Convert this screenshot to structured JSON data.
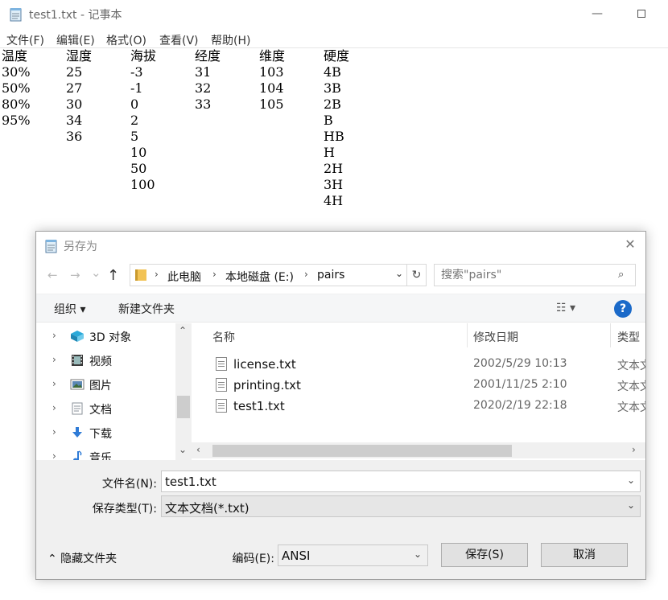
{
  "notepad": {
    "title": "test1.txt - 记事本",
    "min_glyph": "—",
    "menu": [
      "文件(F)",
      "编辑(E)",
      "格式(O)",
      "查看(V)",
      "帮助(H)"
    ],
    "columns": [
      [
        "温度",
        "30%",
        "50%",
        "80%",
        "95%"
      ],
      [
        "湿度",
        "25",
        "27",
        "30",
        "34",
        "36"
      ],
      [
        "海拔",
        "-3",
        "-1",
        "0",
        "2",
        "5",
        "10",
        "50",
        "100"
      ],
      [
        "经度",
        "31",
        "32",
        "33"
      ],
      [
        "维度",
        "103",
        "104",
        "105"
      ],
      [
        "硬度",
        "4B",
        "3B",
        "2B",
        "B",
        "HB",
        "H",
        "2H",
        "3H",
        "4H"
      ]
    ]
  },
  "dialog": {
    "title": "另存为",
    "close_glyph": "✕",
    "nav": {
      "back": "←",
      "forward": "→",
      "recent": "⌄",
      "up": "↑"
    },
    "breadcrumb": [
      "此电脑",
      "本地磁盘 (E:)",
      "pairs"
    ],
    "breadcrumb_sep": "›",
    "dropdown_glyph": "⌄",
    "refresh_glyph": "↻",
    "search_placeholder": "搜索\"pairs\"",
    "search_glyph": "⌕",
    "toolbar": {
      "organize": "组织 ▾",
      "new_folder": "新建文件夹",
      "view": "☷ ▾",
      "help": "?"
    },
    "nav_pane": {
      "caret": "›",
      "scroll_up": "⌃",
      "scroll_down": "⌄",
      "items": [
        {
          "label": "3D 对象",
          "icon": "cube-icon",
          "color": "#2aa9d9"
        },
        {
          "label": "视频",
          "icon": "film-icon",
          "color": "#3a3a3a"
        },
        {
          "label": "图片",
          "icon": "picture-icon",
          "color": "#5b87b5"
        },
        {
          "label": "文档",
          "icon": "document-icon",
          "color": "#8a9099"
        },
        {
          "label": "下载",
          "icon": "download-arrow-icon",
          "color": "#2f7bd6"
        },
        {
          "label": "音乐",
          "icon": "music-note-icon",
          "color": "#2f7bd6"
        }
      ]
    },
    "files": {
      "headers": {
        "name": "名称",
        "date": "修改日期",
        "type": "类型",
        "sort_glyph": "˄"
      },
      "rows": [
        {
          "name": "license.txt",
          "date": "2002/5/29 10:13",
          "type": "文本文档"
        },
        {
          "name": "printing.txt",
          "date": "2001/11/25 2:10",
          "type": "文本文档"
        },
        {
          "name": "test1.txt",
          "date": "2020/2/19 22:18",
          "type": "文本文档"
        }
      ],
      "scroll_left": "‹",
      "scroll_right": "›"
    },
    "filename_label": "文件名(N):",
    "filename_value": "test1.txt",
    "filetype_label": "保存类型(T):",
    "filetype_value": "文本文档(*.txt)",
    "hide_folders": "⌃  隐藏文件夹",
    "encoding_label": "编码(E):",
    "encoding_value": "ANSI",
    "save_button": "保存(S)",
    "cancel_button": "取消"
  }
}
